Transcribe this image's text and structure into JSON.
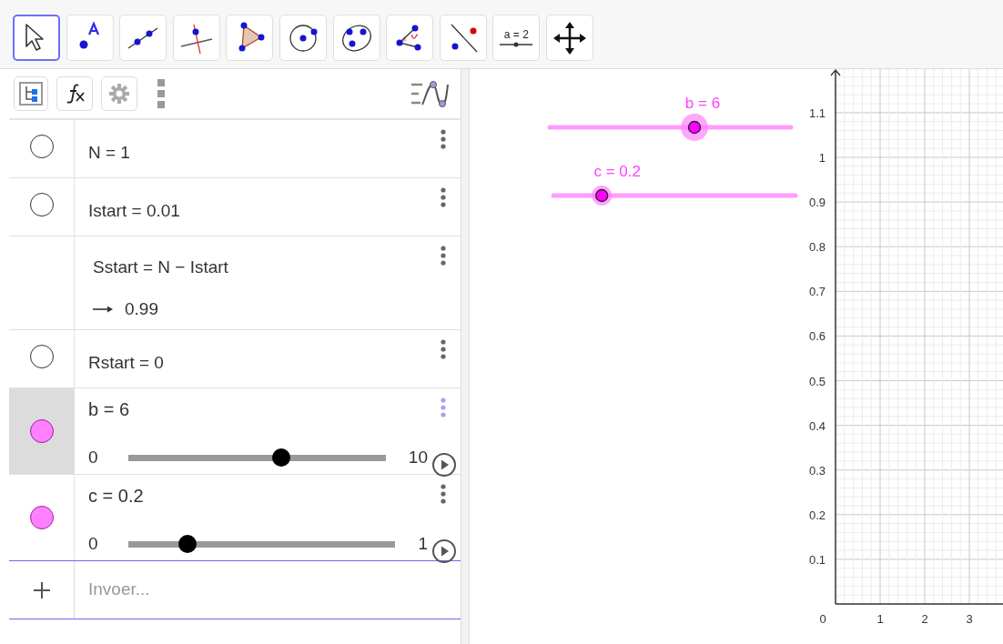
{
  "toolbar": {
    "tools": [
      {
        "kind": "move",
        "selected": true
      },
      {
        "kind": "point",
        "selected": false
      },
      {
        "kind": "line",
        "selected": false
      },
      {
        "kind": "perpendicular",
        "selected": false
      },
      {
        "kind": "polygon",
        "selected": false
      },
      {
        "kind": "circle",
        "selected": false
      },
      {
        "kind": "conic",
        "selected": false
      },
      {
        "kind": "angle",
        "selected": false
      },
      {
        "kind": "reflect",
        "selected": false
      },
      {
        "kind": "slider",
        "selected": false,
        "label": "a = 2"
      },
      {
        "kind": "move_view",
        "selected": false
      }
    ]
  },
  "algebra_view": {
    "rows": [
      {
        "kind": "value",
        "visible": false,
        "selected": false,
        "text": "N = 1"
      },
      {
        "kind": "value",
        "visible": false,
        "selected": false,
        "text": "Istart = 0.01"
      },
      {
        "kind": "dependent",
        "selected": false,
        "text": "Sstart = N − Istart",
        "value": "0.99"
      },
      {
        "kind": "value",
        "visible": false,
        "selected": false,
        "text": "Rstart = 0"
      },
      {
        "kind": "slider",
        "visible": true,
        "selected": true,
        "color": "#ff80ff",
        "text": "b = 6",
        "min": "0",
        "max": "10",
        "level": 0.6
      },
      {
        "kind": "slider",
        "visible": true,
        "selected": false,
        "color": "#ff80ff",
        "text": "c = 0.2",
        "min": "0",
        "max": "1",
        "level": 0.2
      }
    ],
    "input": {
      "placeholder": "Invoer..."
    }
  },
  "graphics_view": {
    "sliders": [
      {
        "label": "b = 6",
        "level": 0.6,
        "selected": true
      },
      {
        "label": "c = 0.2",
        "level": 0.2,
        "selected": false
      }
    ],
    "y_axis_labels": [
      "1.1",
      "1",
      "0.9",
      "0.8",
      "0.7",
      "0.6",
      "0.5",
      "0.4",
      "0.3",
      "0.2",
      "0.1"
    ],
    "origin_label": "0",
    "x_axis_labels": [
      "1",
      "2",
      "3"
    ]
  }
}
